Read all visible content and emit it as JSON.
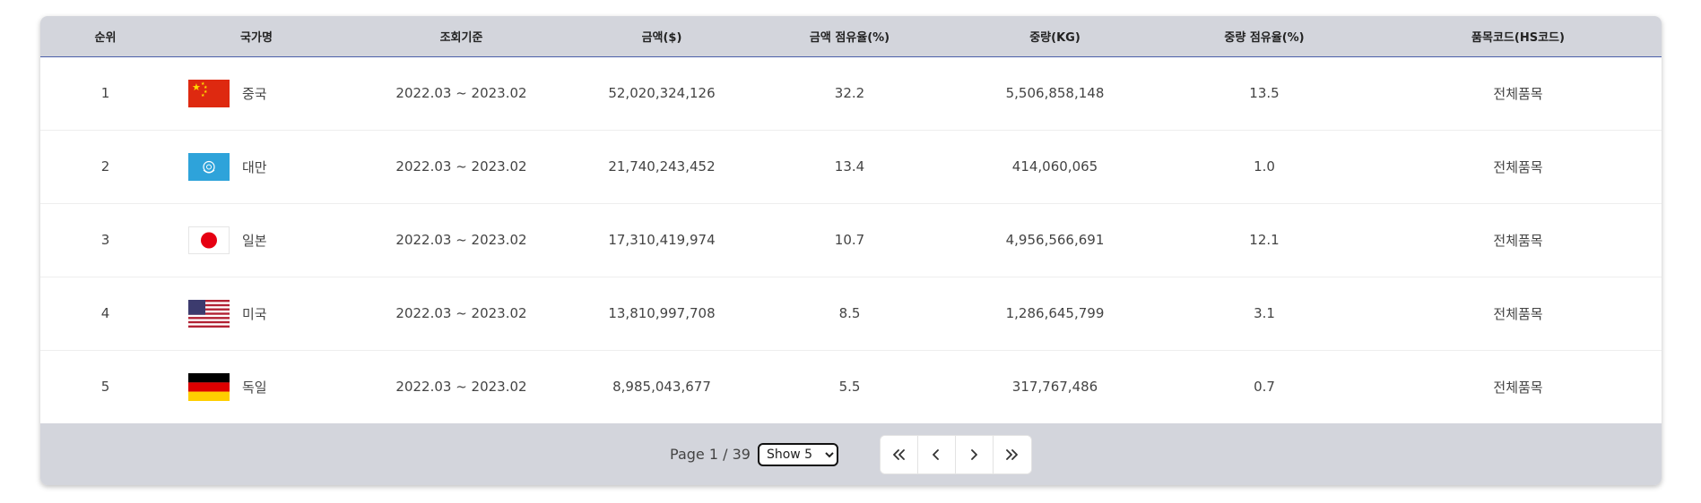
{
  "table": {
    "headers": [
      "순위",
      "국가명",
      "조회기준",
      "금액($)",
      "금액 점유율(%)",
      "중량(KG)",
      "중량 점유율(%)",
      "품목코드(HS코드)"
    ],
    "rows": [
      {
        "rank": "1",
        "flag_icon": "china-flag-icon",
        "country": "중국",
        "period": "2022.03 ~ 2023.02",
        "amount": "52,020,324,126",
        "amount_share": "32.2",
        "weight": "5,506,858,148",
        "weight_share": "13.5",
        "hs_code": "전체품목"
      },
      {
        "rank": "2",
        "flag_icon": "united-nations-flag-icon",
        "country": "대만",
        "period": "2022.03 ~ 2023.02",
        "amount": "21,740,243,452",
        "amount_share": "13.4",
        "weight": "414,060,065",
        "weight_share": "1.0",
        "hs_code": "전체품목"
      },
      {
        "rank": "3",
        "flag_icon": "japan-flag-icon",
        "country": "일본",
        "period": "2022.03 ~ 2023.02",
        "amount": "17,310,419,974",
        "amount_share": "10.7",
        "weight": "4,956,566,691",
        "weight_share": "12.1",
        "hs_code": "전체품목"
      },
      {
        "rank": "4",
        "flag_icon": "usa-flag-icon",
        "country": "미국",
        "period": "2022.03 ~ 2023.02",
        "amount": "13,810,997,708",
        "amount_share": "8.5",
        "weight": "1,286,645,799",
        "weight_share": "3.1",
        "hs_code": "전체품목"
      },
      {
        "rank": "5",
        "flag_icon": "germany-flag-icon",
        "country": "독일",
        "period": "2022.03 ~ 2023.02",
        "amount": "8,985,043,677",
        "amount_share": "5.5",
        "weight": "317,767,486",
        "weight_share": "0.7",
        "hs_code": "전체품목"
      }
    ]
  },
  "pagination": {
    "page_label": "Page 1 / 39",
    "show_selected": "Show 5",
    "buttons": [
      "first-page-icon",
      "previous-page-icon",
      "next-page-icon",
      "last-page-icon"
    ]
  },
  "colors": {
    "header_bg": "#d3d5dc",
    "header_rule": "#4a5ea8",
    "footer_bg": "#d3d5dc"
  }
}
